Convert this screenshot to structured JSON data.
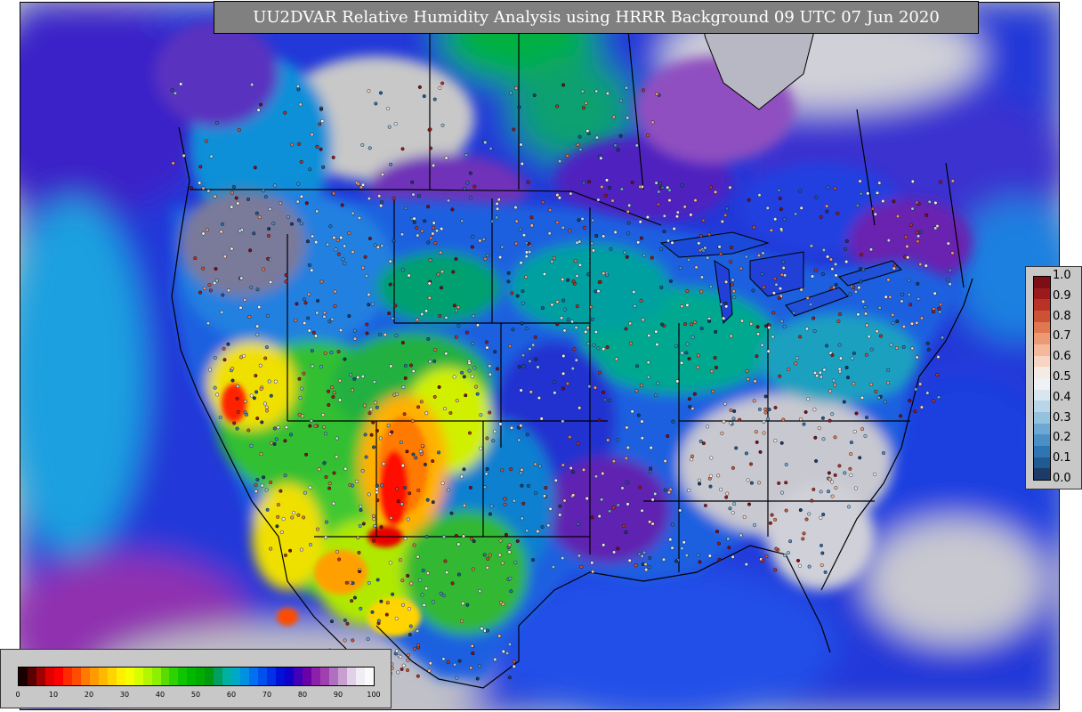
{
  "title": "UU2DVAR Relative Humidity Analysis using HRRR Background 09 UTC 07 Jun 2020",
  "rh_colorbar": {
    "ticks": [
      "0",
      "10",
      "20",
      "30",
      "40",
      "50",
      "60",
      "70",
      "80",
      "90",
      "100"
    ],
    "colors": [
      "#1a0000",
      "#5a0000",
      "#a00000",
      "#e00000",
      "#ff0000",
      "#ff2a00",
      "#ff4c00",
      "#ff7a00",
      "#ff9a00",
      "#ffb800",
      "#ffd400",
      "#ffef00",
      "#f5ff00",
      "#d6ff00",
      "#b4f500",
      "#8cf000",
      "#5adc00",
      "#2ed200",
      "#10c400",
      "#00b800",
      "#00ac00",
      "#009a10",
      "#00a060",
      "#00b0a0",
      "#00a8c8",
      "#0090e0",
      "#0070f0",
      "#0050f0",
      "#0030e8",
      "#0010d8",
      "#1000c8",
      "#4000b8",
      "#6a00a8",
      "#8c20a8",
      "#a040b0",
      "#b070c0",
      "#c8a0d0",
      "#e0d0e8",
      "#f0eef4",
      "#fafafa"
    ]
  },
  "innov_colorbar": {
    "ticks": [
      "0.0",
      "0.1",
      "0.2",
      "0.3",
      "0.4",
      "0.5",
      "0.6",
      "0.7",
      "0.8",
      "0.9",
      "1.0"
    ],
    "colors": [
      "#1c3b66",
      "#1f5a93",
      "#2f74b3",
      "#4a90c6",
      "#6da8d3",
      "#94c1de",
      "#b9d6e8",
      "#d7e6ef",
      "#eef2f4",
      "#f5eae4",
      "#f7d5c2",
      "#f4b99b",
      "#ec9a74",
      "#e0774f",
      "#cd5235",
      "#b83226",
      "#9c1a1c",
      "#7e0d16"
    ]
  },
  "legend_colors": {
    "background": "#c8c8c8",
    "title_bg": "#808080",
    "ocean": "#1a3ad8",
    "land_moist": "#00a860",
    "land_dry": "#ffd400",
    "land_very_dry": "#e80000",
    "outline": "#000000"
  }
}
